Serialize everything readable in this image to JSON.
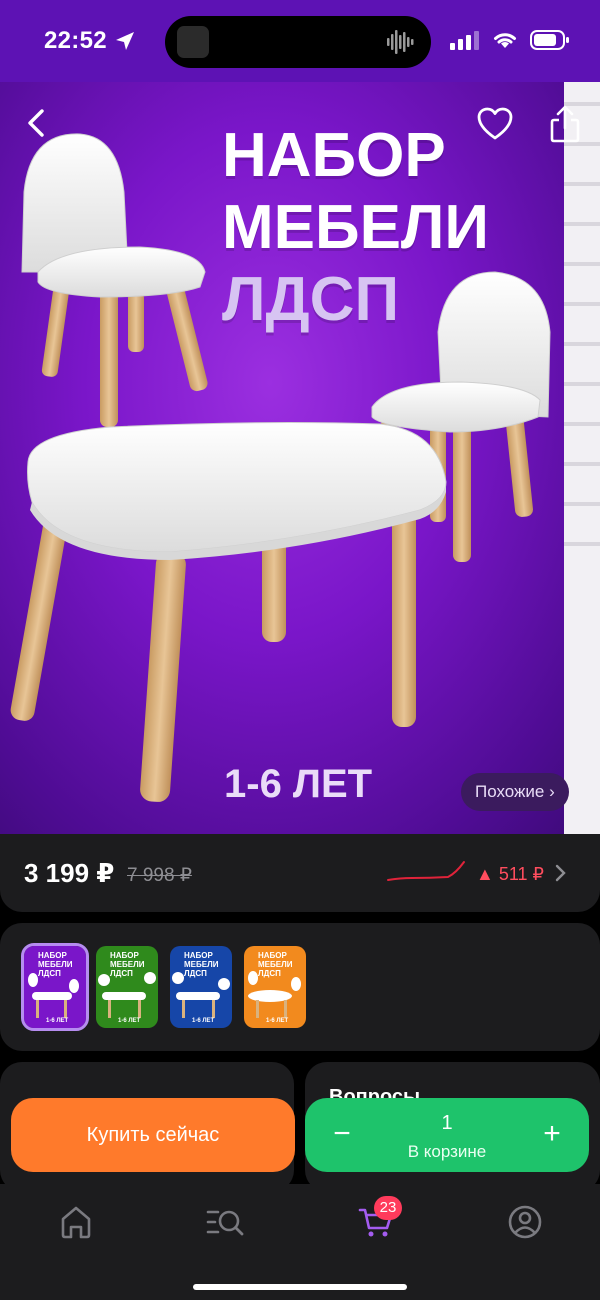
{
  "status_bar": {
    "time": "22:52"
  },
  "hero": {
    "title_lines": [
      "НАБОР",
      "МЕБЕЛИ",
      "ЛДСП"
    ],
    "age": "1-6 ЛЕТ",
    "similar_label": "Похожие ›"
  },
  "price": {
    "current": "3 199 ₽",
    "old": "7 998 ₽",
    "change": "▲ 511 ₽",
    "trend_color": "#ff4d5e"
  },
  "variants": [
    {
      "title": "НАБОР\nМЕБЕЛИ\nЛДСП",
      "age": "1-6 ЛЕТ",
      "color": "#7a16c9",
      "selected": true
    },
    {
      "title": "НАБОР\nМЕБЕЛИ\nЛДСП",
      "age": "1-6 ЛЕТ",
      "color": "#2f8a1c",
      "selected": false
    },
    {
      "title": "НАБОР\nМЕБЕЛИ\nЛДСП",
      "age": "1-6 ЛЕТ",
      "color": "#1646a8",
      "selected": false
    },
    {
      "title": "НАБОР\nМЕБЕЛИ\nЛДСП",
      "age": "1-6 ЛЕТ",
      "color": "#f28a1e",
      "selected": false
    }
  ],
  "questions_card": {
    "title": "Вопросы"
  },
  "actions": {
    "buy_label": "Купить сейчас",
    "buy_color": "#ff7a2b",
    "cart_qty": "1",
    "cart_label": "В корзине",
    "cart_color": "#1ec36b",
    "minus": "−",
    "plus": "+"
  },
  "tabbar": {
    "items": [
      "home-icon",
      "catalog-search-icon",
      "cart-icon",
      "profile-icon"
    ],
    "cart_badge": "23",
    "active_color": "#a45cf0"
  }
}
